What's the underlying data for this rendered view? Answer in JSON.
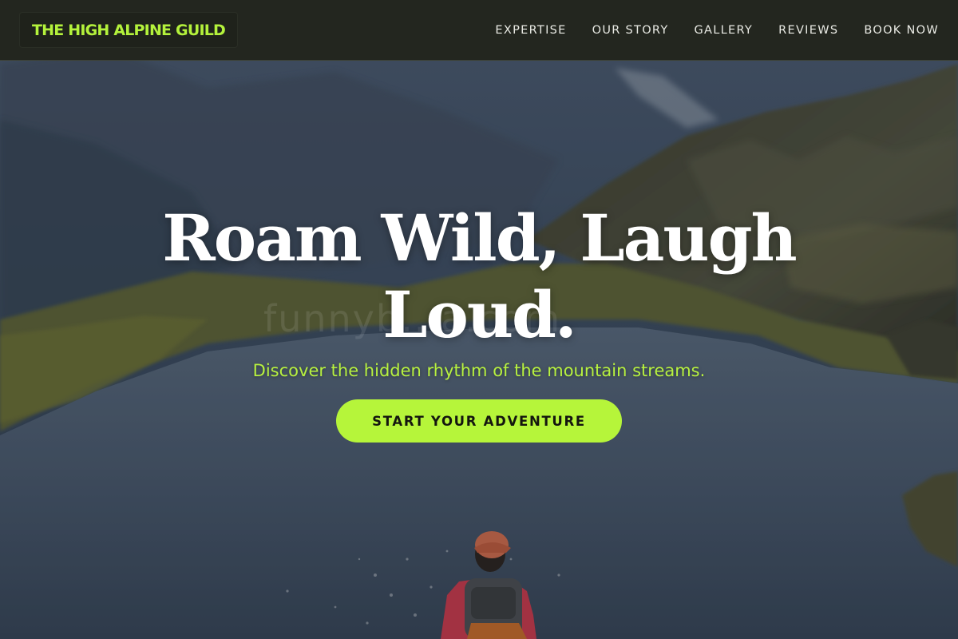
{
  "brand": {
    "name": "THE HIGH ALPINE GUILD",
    "accent_color": "#b4f23c"
  },
  "nav": {
    "items": [
      {
        "label": "EXPERTISE"
      },
      {
        "label": "OUR STORY"
      },
      {
        "label": "GALLERY"
      },
      {
        "label": "REVIEWS"
      },
      {
        "label": "BOOK NOW"
      }
    ]
  },
  "hero": {
    "title": "Roam Wild, Laugh Loud.",
    "subtitle": "Discover the hidden rhythm of the mountain streams.",
    "cta_label": "START YOUR ADVENTURE",
    "cta_color": "#b6f53a",
    "watermark": "funnyb...a.com",
    "background_scene": "mountain-lake-hiker-photo"
  }
}
